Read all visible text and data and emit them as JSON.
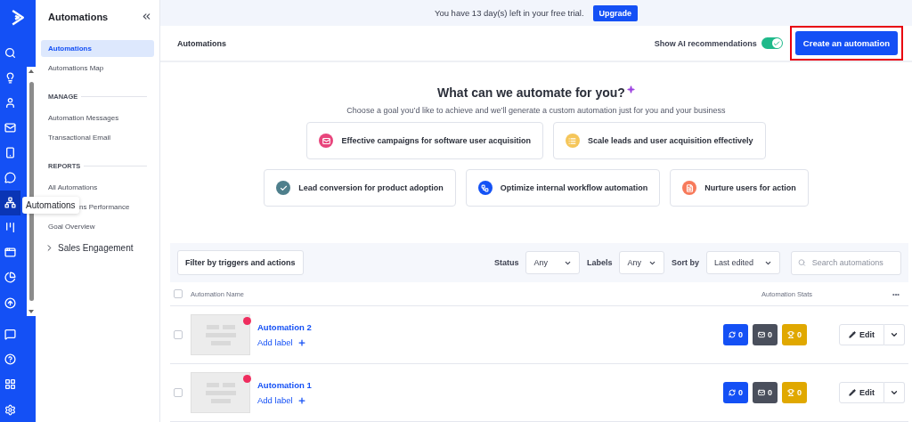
{
  "rail": {
    "items": [
      {
        "kind": "search",
        "selected": false
      },
      {
        "kind": "bulb",
        "selected": false
      },
      {
        "kind": "contacts",
        "selected": false
      },
      {
        "kind": "mail",
        "selected": false
      },
      {
        "kind": "phone",
        "selected": false
      },
      {
        "kind": "chat",
        "selected": false
      },
      {
        "kind": "automations",
        "selected": true
      },
      {
        "kind": "board",
        "selected": false
      },
      {
        "kind": "window",
        "selected": false
      },
      {
        "kind": "pie",
        "selected": false
      },
      {
        "kind": "upload",
        "selected": false
      }
    ],
    "bottom": [
      {
        "kind": "message"
      },
      {
        "kind": "help"
      },
      {
        "kind": "apps"
      },
      {
        "kind": "settings"
      }
    ],
    "tooltip": "Automations"
  },
  "sidebar": {
    "title": "Automations",
    "sections": [
      {
        "items": [
          {
            "label": "Automations",
            "selected": true
          },
          {
            "label": "Automations Map",
            "selected": false
          }
        ]
      },
      {
        "heading": "MANAGE",
        "items": [
          {
            "label": "Automation Messages",
            "selected": false
          },
          {
            "label": "Transactional Email",
            "selected": false
          }
        ]
      },
      {
        "heading": "REPORTS",
        "items": [
          {
            "label": "All Automations",
            "selected": false
          },
          {
            "label": "ns Performance",
            "selected": false
          },
          {
            "label": "Goal Overview",
            "selected": false
          }
        ]
      }
    ],
    "group": {
      "label": "Sales Engagement",
      "expanded": false
    }
  },
  "banner": {
    "text": "You have 13 day(s) left in your free trial.",
    "button": "Upgrade"
  },
  "header": {
    "title": "Automations",
    "toggle": {
      "label": "Show AI recommendations",
      "on": true
    },
    "create_button": "Create an automation"
  },
  "ai": {
    "title": "What can we automate for you?",
    "subtitle": "Choose a goal you’d like to achieve and we’ll generate a custom automation just for you and your business",
    "goals": [
      [
        {
          "label": "Effective campaigns for software user acquisition",
          "kind": "mail",
          "color": "#e8457c"
        },
        {
          "label": "Scale leads and user acquisition effectively",
          "kind": "list",
          "color": "#f5c65a"
        }
      ],
      [
        {
          "label": "Lead conversion for product adoption",
          "kind": "check",
          "color": "#4e7f8c"
        },
        {
          "label": "Optimize internal workflow automation",
          "kind": "flow",
          "color": "#1452f5"
        },
        {
          "label": "Nurture users for action",
          "kind": "form",
          "color": "#f77a5b"
        }
      ]
    ]
  },
  "filters": {
    "filter_button": "Filter by triggers and actions",
    "status": {
      "label": "Status",
      "value": "Any"
    },
    "labels": {
      "label": "Labels",
      "value": "Any"
    },
    "sort": {
      "label": "Sort by",
      "value": "Last edited"
    },
    "search": {
      "placeholder": "Search automations"
    }
  },
  "table": {
    "select_all": {
      "checked": false
    },
    "columns": [
      "Automation Name",
      "Automation Stats",
      "•••"
    ],
    "rows": [
      {
        "name": "Automation 2",
        "add_label": "Add label",
        "checked": false,
        "stats": [
          {
            "kind": "runs",
            "value": "0"
          },
          {
            "kind": "emails",
            "value": "0"
          },
          {
            "kind": "goals",
            "value": "0"
          }
        ],
        "edit": "Edit"
      },
      {
        "name": "Automation 1",
        "add_label": "Add label",
        "checked": false,
        "stats": [
          {
            "kind": "runs",
            "value": "0"
          },
          {
            "kind": "emails",
            "value": "0"
          },
          {
            "kind": "goals",
            "value": "0"
          }
        ],
        "edit": "Edit"
      }
    ]
  }
}
